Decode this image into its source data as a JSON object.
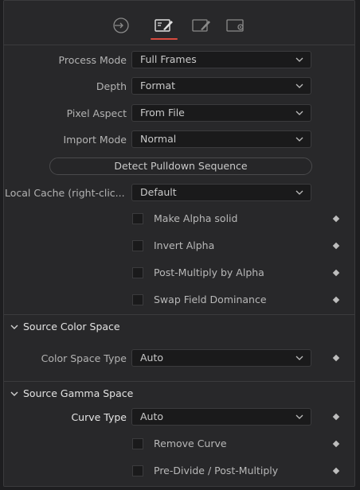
{
  "tabs": [
    {
      "icon": "import-icon"
    },
    {
      "icon": "image-tab-icon",
      "active": true
    },
    {
      "icon": "edit-tab-icon"
    },
    {
      "icon": "settings-tab-icon"
    }
  ],
  "colors": {
    "accent": "#d84b3f",
    "background": "#28282a",
    "field": "#1a1a1b"
  },
  "fields": {
    "process_mode": {
      "label": "Process Mode",
      "value": "Full Frames"
    },
    "depth": {
      "label": "Depth",
      "value": "Format"
    },
    "pixel_aspect": {
      "label": "Pixel Aspect",
      "value": "From File"
    },
    "import_mode": {
      "label": "Import Mode",
      "value": "Normal"
    },
    "detect_pulldown": {
      "label": "Detect Pulldown Sequence"
    },
    "local_cache": {
      "label": "Local Cache (right-clic...",
      "value": "Default"
    }
  },
  "checkboxes": {
    "make_alpha_solid": {
      "label": "Make Alpha solid",
      "checked": false
    },
    "invert_alpha": {
      "label": "Invert Alpha",
      "checked": false
    },
    "post_multiply": {
      "label": "Post-Multiply by Alpha",
      "checked": false
    },
    "swap_field": {
      "label": "Swap Field Dominance",
      "checked": false
    }
  },
  "source_color_space": {
    "title": "Source Color Space",
    "color_space_type": {
      "label": "Color Space Type",
      "value": "Auto"
    }
  },
  "source_gamma_space": {
    "title": "Source Gamma Space",
    "curve_type": {
      "label": "Curve Type",
      "value": "Auto"
    },
    "remove_curve": {
      "label": "Remove Curve",
      "checked": false
    },
    "pre_divide": {
      "label": "Pre-Divide / Post-Multiply",
      "checked": false
    }
  }
}
